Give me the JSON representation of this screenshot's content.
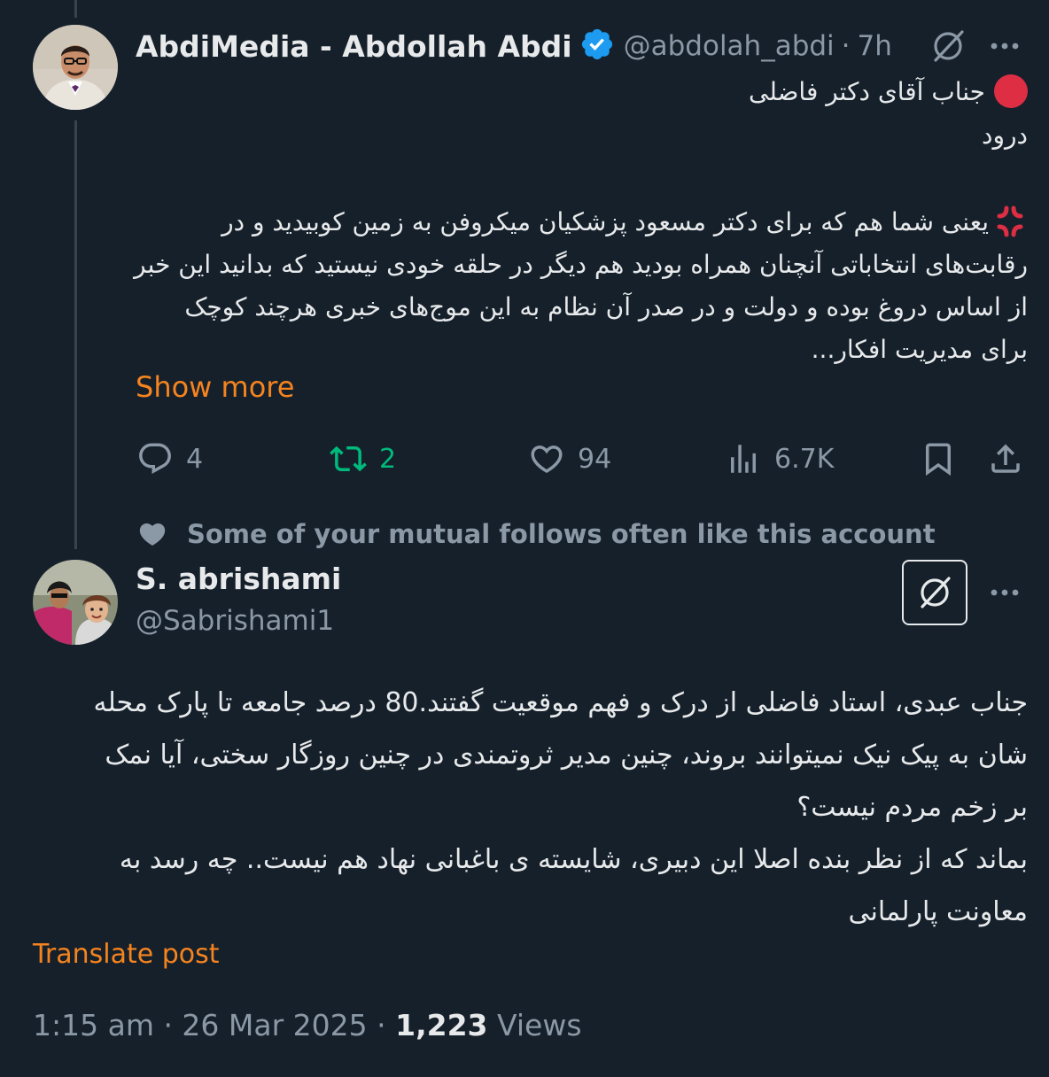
{
  "post1": {
    "author_name": "AbdiMedia - Abdollah Abdi",
    "handle": "@abdolah_abdi",
    "sep": "·",
    "time": "7h",
    "lines": [
      "جناب آقای دکتر فاضلی",
      "درود",
      "یعنی شما هم که برای دکتر مسعود پزشکیان میکروفن به زمین کوبیدید و در",
      "رقابت‌های انتخاباتی آنچنان همراه بودید هم دیگر در حلقه خودی نیستید که بدانید این خبر",
      "از اساس دروغ بوده و دولت و در صدر آن نظام به این موج‌های خبری هرچند کوچک",
      "برای مدیریت افکار..."
    ],
    "show_more": "Show more",
    "actions": {
      "replies": "4",
      "reposts": "2",
      "likes": "94",
      "views": "6.7K"
    },
    "colors": {
      "verified": "#1d9bf0",
      "red_circle": "#dd2e44",
      "anger": "#dd2e44"
    }
  },
  "social_context": "Some of your mutual follows often like this account",
  "post2": {
    "author_name": "S. abrishami",
    "handle": "@Sabrishami1",
    "lines": [
      "جناب عبدی، استاد فاضلی از درک و فهم موقعیت گفتند.80 درصد جامعه تا پارک محله",
      "شان به پیک نیک نمیتوانند بروند، چنین مدیر ثروتمندی در چنین روزگار سختی، آیا نمک",
      "بر زخم مردم نیست؟",
      "بماند که از نظر بنده اصلا این دبیری، شایسته ی باغبانی نهاد هم نیست.. چه رسد به",
      "معاونت پارلمانی"
    ],
    "translate": "Translate post",
    "timestamp": "1:15 am · 26 Mar 2025 ·",
    "views_count": "1,223",
    "views_label": "Views"
  },
  "icons": {
    "grok": "grok-icon",
    "more": "more-icon",
    "reply": "reply-icon",
    "repost": "repost-icon",
    "like": "like-icon",
    "analytics": "analytics-icon",
    "bookmark": "bookmark-icon",
    "share": "share-icon",
    "heart_context": "heart-icon"
  },
  "theme": {
    "background": "#15202b",
    "accent_link": "#f5841f",
    "muted": "#8b98a5",
    "repost_green": "#00ba7c"
  }
}
